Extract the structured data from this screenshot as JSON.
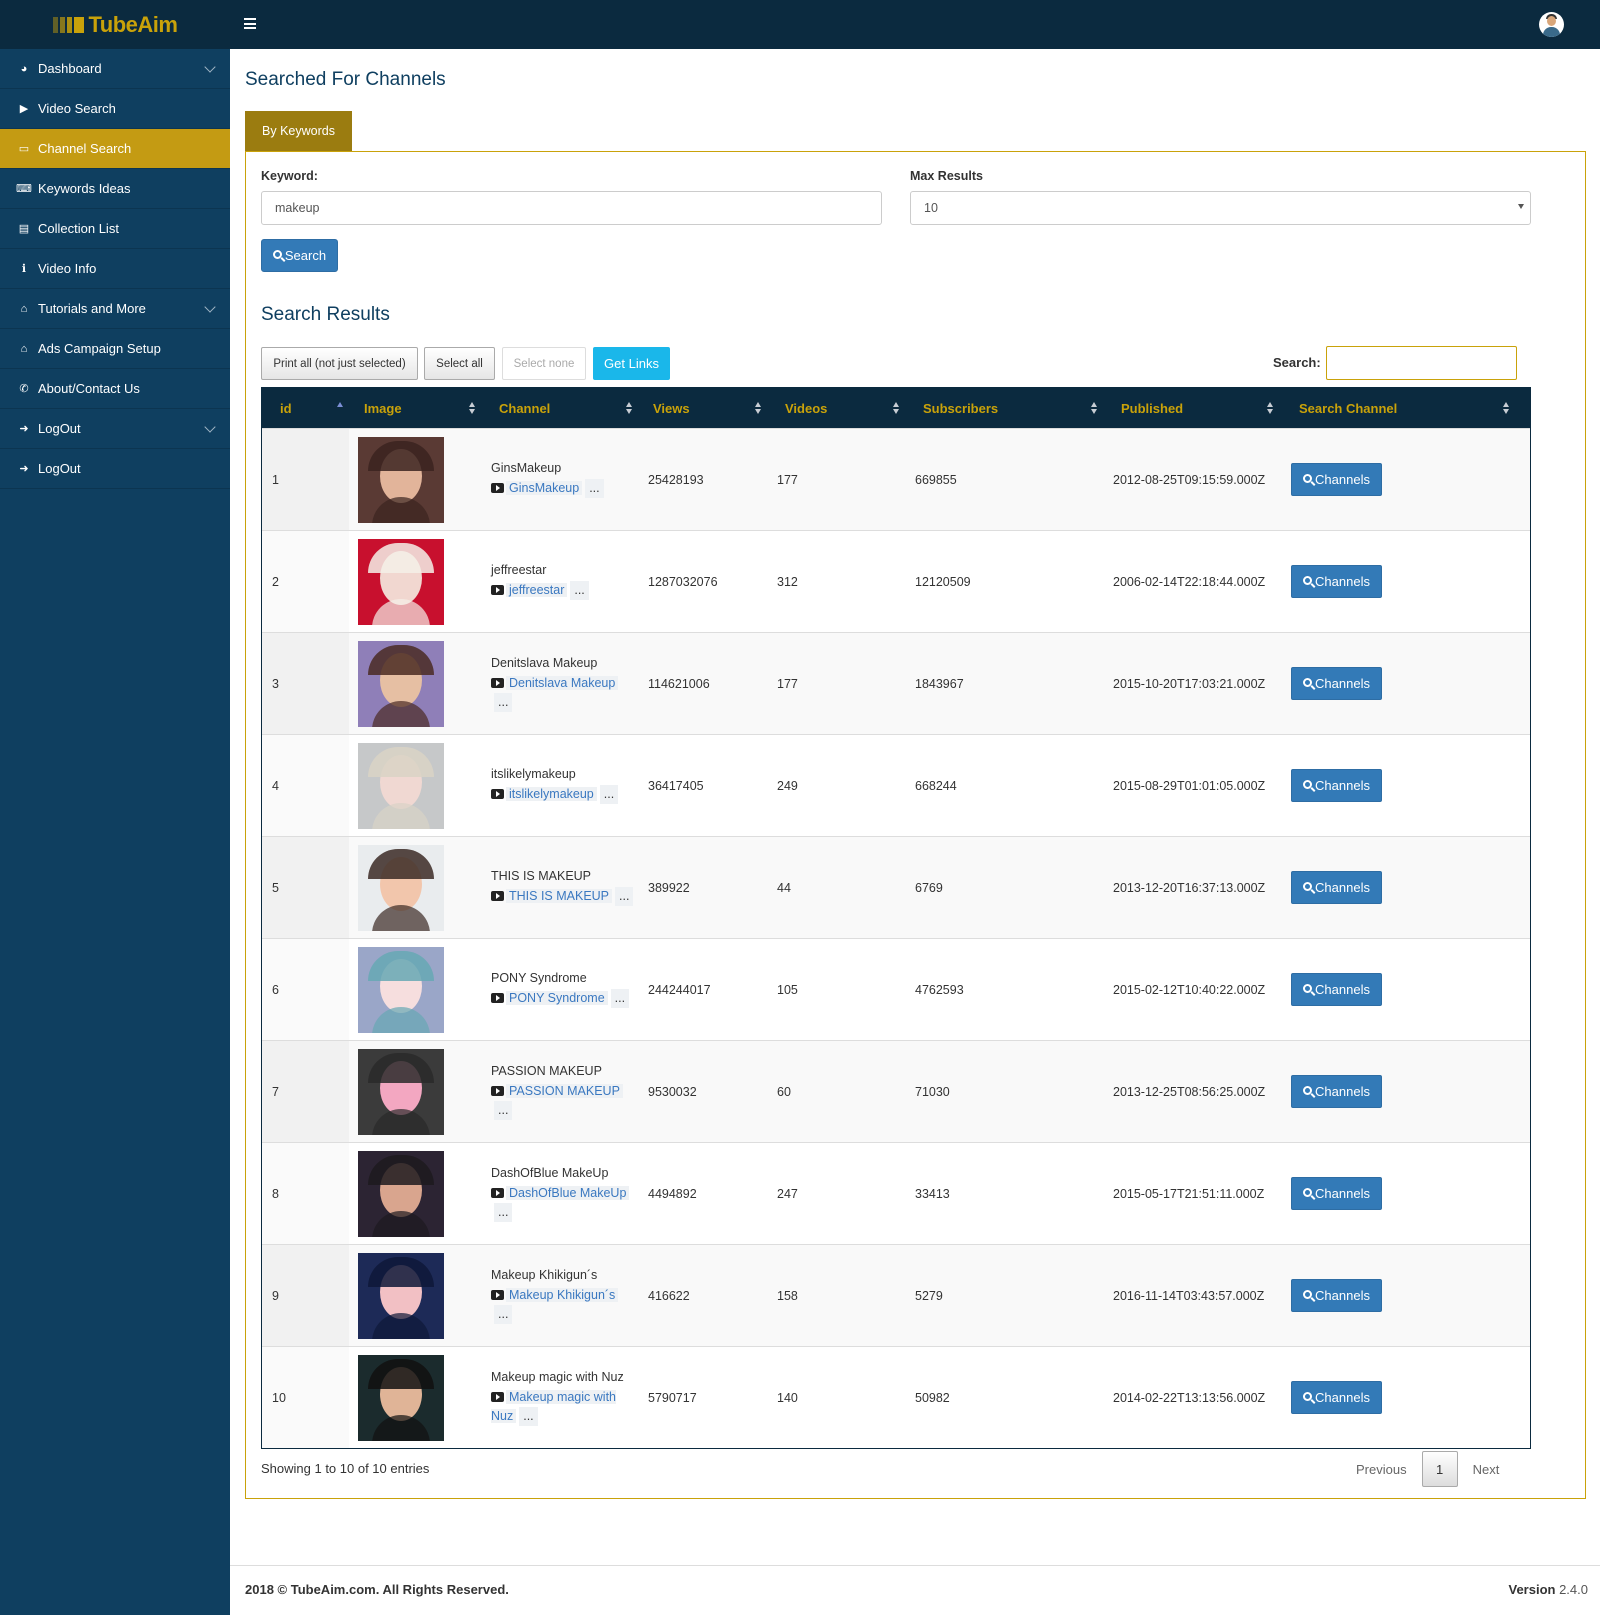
{
  "app": {
    "name": "TubeAim"
  },
  "sidebar": {
    "items": [
      {
        "label": "Dashboard",
        "icon": "dashboard-icon",
        "glyph": "◕",
        "expandable": true
      },
      {
        "label": "Video Search",
        "icon": "video-icon",
        "glyph": "▶",
        "expandable": false
      },
      {
        "label": "Channel Search",
        "icon": "monitor-icon",
        "glyph": "▭",
        "expandable": false,
        "active": true
      },
      {
        "label": "Keywords Ideas",
        "icon": "keyboard-icon",
        "glyph": "⌨",
        "expandable": false
      },
      {
        "label": "Collection List",
        "icon": "address-book-icon",
        "glyph": "▤",
        "expandable": false
      },
      {
        "label": "Video Info",
        "icon": "info-icon",
        "glyph": "ℹ",
        "expandable": false
      },
      {
        "label": "Tutorials and More",
        "icon": "bank-icon",
        "glyph": "⌂",
        "expandable": true
      },
      {
        "label": "Ads Campaign Setup",
        "icon": "bank-icon",
        "glyph": "⌂",
        "expandable": false
      },
      {
        "label": "About/Contact Us",
        "icon": "phone-icon",
        "glyph": "✆",
        "expandable": false
      },
      {
        "label": "LogOut",
        "icon": "sign-out-icon",
        "glyph": "➜",
        "expandable": true
      },
      {
        "label": "LogOut",
        "icon": "sign-out-icon",
        "glyph": "➜",
        "expandable": false
      }
    ]
  },
  "page": {
    "title": "Searched For Channels",
    "tab": "By Keywords"
  },
  "form": {
    "keyword_label": "Keyword:",
    "keyword_value": "makeup",
    "max_label": "Max Results",
    "max_value": "10",
    "search_button": "Search"
  },
  "results": {
    "title": "Search Results",
    "buttons": {
      "print_all": "Print all (not just selected)",
      "select_all": "Select all",
      "select_none": "Select none",
      "get_links": "Get Links"
    },
    "search_label": "Search:",
    "columns": [
      "id",
      "Image",
      "Channel",
      "Views",
      "Videos",
      "Subscribers",
      "Published",
      "Search Channel"
    ],
    "rows": [
      {
        "id": "1",
        "channel": "GinsMakeup",
        "link": "GinsMakeup",
        "views": "25428193",
        "videos": "177",
        "subscribers": "669855",
        "published": "2012-08-25T09:15:59.000Z"
      },
      {
        "id": "2",
        "channel": "jeffreestar",
        "link": "jeffreestar",
        "views": "1287032076",
        "videos": "312",
        "subscribers": "12120509",
        "published": "2006-02-14T22:18:44.000Z"
      },
      {
        "id": "3",
        "channel": "Denitslava Makeup",
        "link": "Denitslava Makeup",
        "views": "114621006",
        "videos": "177",
        "subscribers": "1843967",
        "published": "2015-10-20T17:03:21.000Z"
      },
      {
        "id": "4",
        "channel": "itslikelymakeup",
        "link": "itslikelymakeup",
        "views": "36417405",
        "videos": "249",
        "subscribers": "668244",
        "published": "2015-08-29T01:01:05.000Z"
      },
      {
        "id": "5",
        "channel": "THIS IS MAKEUP",
        "link": "THIS IS MAKEUP",
        "views": "389922",
        "videos": "44",
        "subscribers": "6769",
        "published": "2013-12-20T16:37:13.000Z"
      },
      {
        "id": "6",
        "channel": "PONY Syndrome",
        "link": "PONY Syndrome",
        "views": "244244017",
        "videos": "105",
        "subscribers": "4762593",
        "published": "2015-02-12T10:40:22.000Z"
      },
      {
        "id": "7",
        "channel": "PASSION MAKEUP",
        "link": "PASSION MAKEUP",
        "views": "9530032",
        "videos": "60",
        "subscribers": "71030",
        "published": "2013-12-25T08:56:25.000Z"
      },
      {
        "id": "8",
        "channel": "DashOfBlue MakeUp",
        "link": "DashOfBlue MakeUp",
        "views": "4494892",
        "videos": "247",
        "subscribers": "33413",
        "published": "2015-05-17T21:51:11.000Z"
      },
      {
        "id": "9",
        "channel": "Makeup Khikigun´s",
        "link": "Makeup Khikigun´s",
        "views": "416622",
        "videos": "158",
        "subscribers": "5279",
        "published": "2016-11-14T03:43:57.000Z"
      },
      {
        "id": "10",
        "channel": "Makeup magic with Nuz",
        "link": "Makeup magic with Nuz",
        "views": "5790717",
        "videos": "140",
        "subscribers": "50982",
        "published": "2014-02-22T13:13:56.000Z"
      }
    ],
    "row_button": "Channels",
    "more": "...",
    "showing": "Showing 1 to 10 of 10 entries",
    "pagination": {
      "previous": "Previous",
      "page": "1",
      "next": "Next"
    }
  },
  "footer": {
    "copyright": "2018 © TubeAim.com. All Rights Reserved.",
    "version_label": "Version",
    "version": "2.4.0"
  },
  "colors": {
    "sidebar": "#0f3f60",
    "topbar": "#0b2a3f",
    "accent": "#c49b13",
    "primary": "#337ab7",
    "cyan": "#1ab7ea"
  }
}
